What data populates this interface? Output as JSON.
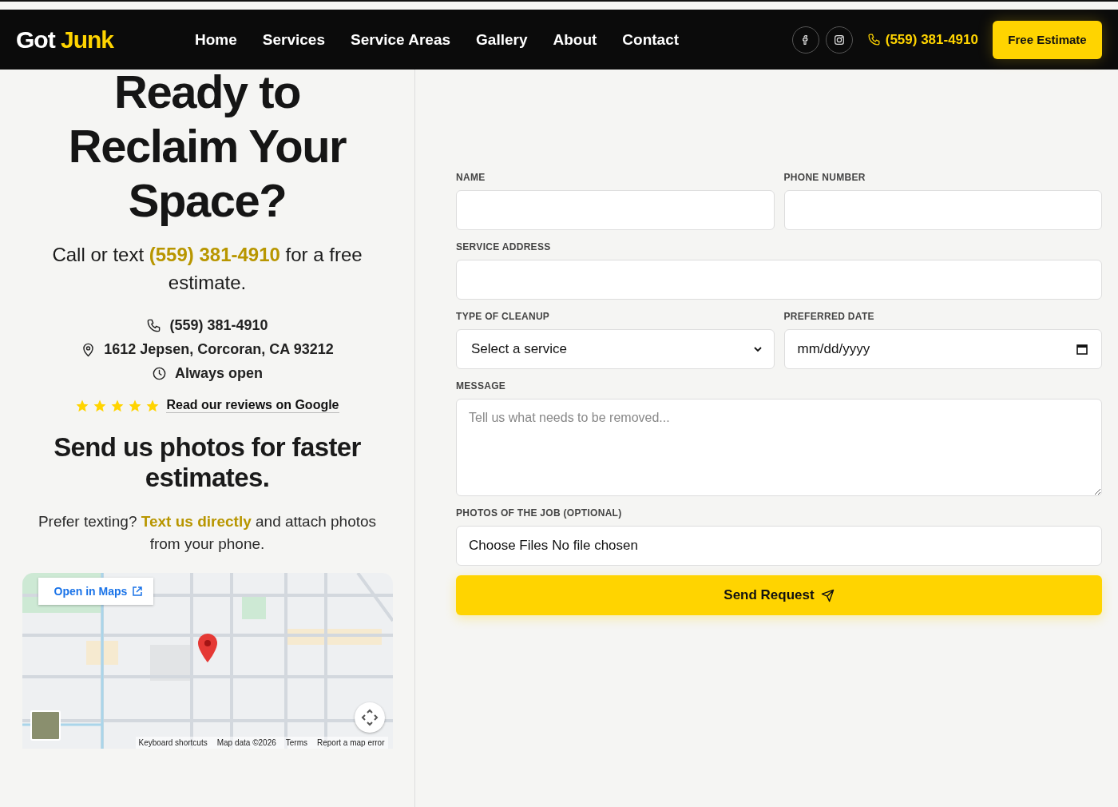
{
  "header": {
    "logo": {
      "part_1": "Got",
      "part_2": "Junk"
    },
    "nav": [
      {
        "label": "Home"
      },
      {
        "label": "Services"
      },
      {
        "label": "Service Areas"
      },
      {
        "label": "Gallery"
      },
      {
        "label": "About"
      },
      {
        "label": "Contact"
      }
    ],
    "social": [
      {
        "kind": "facebook"
      },
      {
        "kind": "instagram"
      }
    ],
    "phone": "(559) 381-4910",
    "cta": "Free Estimate"
  },
  "hero": {
    "title": "Ready to Reclaim Your Space?",
    "call": {
      "before": "Call or text",
      "link": "(559) 381-4910",
      "after": "for a free estimate."
    },
    "contacts": [
      {
        "kind": "phone",
        "text": "(559) 381-4910"
      },
      {
        "kind": "address",
        "text": "1612 Jepsen, Corcoran, CA 93212"
      },
      {
        "kind": "hours",
        "text": "Always open"
      }
    ],
    "reviews": {
      "stars": 5,
      "link": "Read our reviews on Google"
    },
    "photos_heading": "Send us photos for faster estimates.",
    "photos_text": {
      "before": "Prefer texting?",
      "link": "Text us directly",
      "after": "and attach photos from your phone."
    },
    "map": {
      "open_button": "Open in Maps",
      "footer": [
        "Keyboard shortcuts",
        "Map data ©2026",
        "Terms",
        "Report a map error"
      ]
    }
  },
  "form": {
    "rows": [
      [
        {
          "kind": "text",
          "label": "NAME"
        },
        {
          "kind": "text",
          "label": "PHONE NUMBER"
        }
      ],
      [
        {
          "kind": "text",
          "label": "SERVICE ADDRESS"
        }
      ],
      [
        {
          "kind": "select",
          "label": "TYPE OF CLEANUP",
          "value": "Select a service"
        },
        {
          "kind": "date",
          "label": "PREFERRED DATE",
          "placeholder": "mm/dd/yyyy"
        }
      ],
      [
        {
          "kind": "textarea",
          "label": "MESSAGE",
          "placeholder": "Tell us what needs to be removed..."
        }
      ],
      [
        {
          "kind": "file",
          "label": "PHOTOS OF THE JOB (OPTIONAL)",
          "button": "Choose Files",
          "value": "No file chosen"
        }
      ]
    ],
    "submit": "Send Request"
  }
}
